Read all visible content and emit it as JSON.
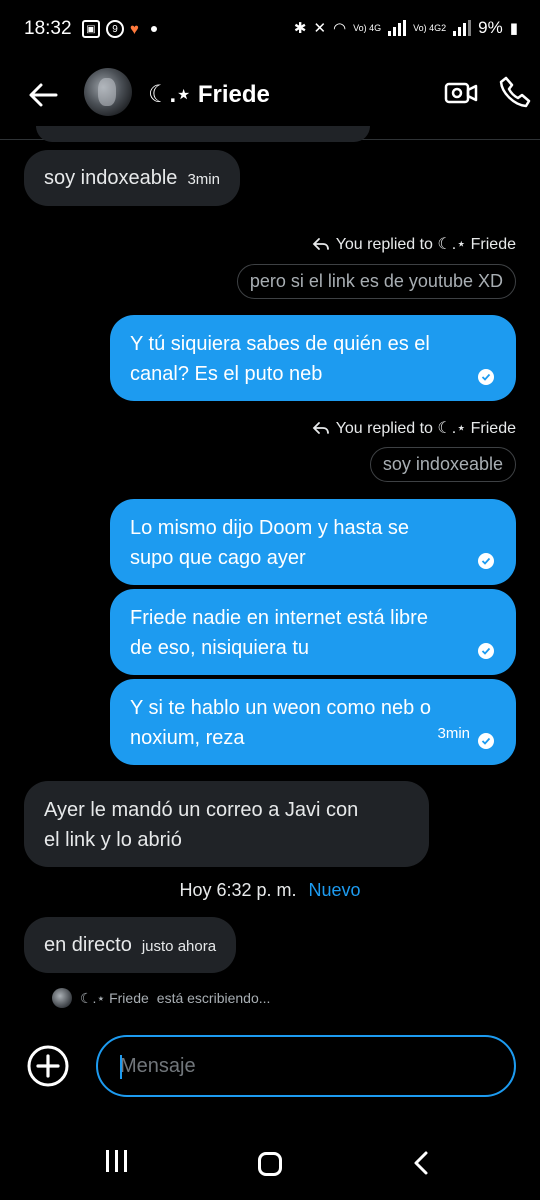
{
  "status_bar": {
    "time": "18:32",
    "notification_badge": "9",
    "battery": "9%",
    "network_label_1": "Vo) 4G",
    "network_label_2": "Vo) 4G2"
  },
  "header": {
    "contact_name": "☾.⋆ Friede",
    "back_icon": "arrow-left-icon",
    "video_icon": "video-call-icon",
    "phone_icon": "phone-icon"
  },
  "messages": [
    {
      "type": "in",
      "text": "soy indoxeable",
      "time": "3min"
    },
    {
      "reply_label": "You replied to ☾.⋆ Friede",
      "quote": "pero si el link es de youtube XD"
    },
    {
      "type": "out",
      "line1": "Y tú siquiera sabes de quién es el",
      "line2": "canal? Es el puto neb"
    },
    {
      "reply_label": "You replied to ☾.⋆ Friede",
      "quote": "soy indoxeable"
    },
    {
      "type": "out",
      "line1": "Lo mismo dijo Doom y hasta se",
      "line2": "supo que cago ayer"
    },
    {
      "type": "out",
      "line1": "Friede nadie en internet está libre",
      "line2": "de eso, nisiquiera tu"
    },
    {
      "type": "out",
      "line1": "Y si te hablo un weon como neb o",
      "line2": "noxium, reza",
      "time": "3min"
    },
    {
      "type": "in",
      "line1": "Ayer le mandó un correo a Javi con",
      "line2": "el link y lo abrió"
    },
    {
      "type": "in",
      "text": "en directo",
      "time": "justo ahora"
    }
  ],
  "divider": {
    "time": "Hoy 6:32 p. m.",
    "new_label": "Nuevo"
  },
  "typing": {
    "name": "☾.⋆ Friede",
    "status": "está escribiendo..."
  },
  "composer": {
    "placeholder": "Mensaje"
  },
  "colors": {
    "accent": "#1d9bf0",
    "incoming_bubble": "#202327",
    "background": "#000000"
  }
}
